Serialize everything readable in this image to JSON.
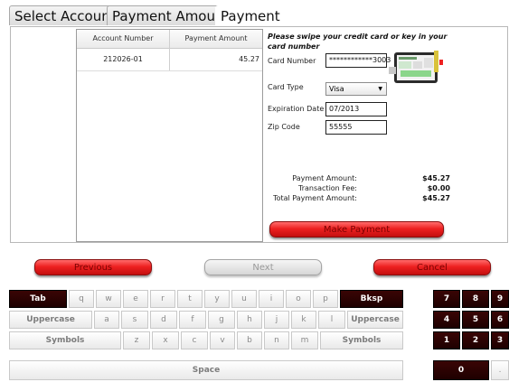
{
  "tabs": [
    "Select Accounts",
    "Payment Amounts",
    "Payment"
  ],
  "grid": {
    "headers": [
      "Account Number",
      "Payment Amount"
    ],
    "rows": [
      [
        "212026-01",
        "45.27"
      ]
    ]
  },
  "form": {
    "instruction": "Please swipe your credit card or key in your card number",
    "card_number_label": "Card Number",
    "card_number_value": "************3003",
    "card_type_label": "Card Type",
    "card_type_value": "Visa",
    "expiration_label": "Expiration Date",
    "expiration_value": "07/2013",
    "zip_label": "Zip Code",
    "zip_value": "55555"
  },
  "summary": {
    "payment_amount_label": "Payment Amount:",
    "payment_amount_value": "$45.27",
    "transaction_fee_label": "Transaction Fee:",
    "transaction_fee_value": "$0.00",
    "total_label": "Total Payment Amount:",
    "total_value": "$45.27"
  },
  "buttons": {
    "make_payment": "Make Payment",
    "previous": "Previous",
    "next": "Next",
    "cancel": "Cancel"
  },
  "keyboard": {
    "row1": [
      "Tab",
      "q",
      "w",
      "e",
      "r",
      "t",
      "y",
      "u",
      "i",
      "o",
      "p",
      "Bksp"
    ],
    "row2": [
      "Uppercase",
      "a",
      "s",
      "d",
      "f",
      "g",
      "h",
      "j",
      "k",
      "l",
      "Uppercase"
    ],
    "row3": [
      "Symbols",
      "z",
      "x",
      "c",
      "v",
      "b",
      "n",
      "m",
      "Symbols"
    ],
    "row4": [
      "Space"
    ],
    "numpad": [
      "7",
      "8",
      "9",
      "4",
      "5",
      "6",
      "1",
      "2",
      "3",
      "0",
      "."
    ]
  },
  "colors": {
    "red_button": "#ee2121",
    "dark_key": "#2a0202",
    "accent_green": "#22aa22"
  },
  "icons": {
    "card_reader": "card-reader-icon"
  }
}
